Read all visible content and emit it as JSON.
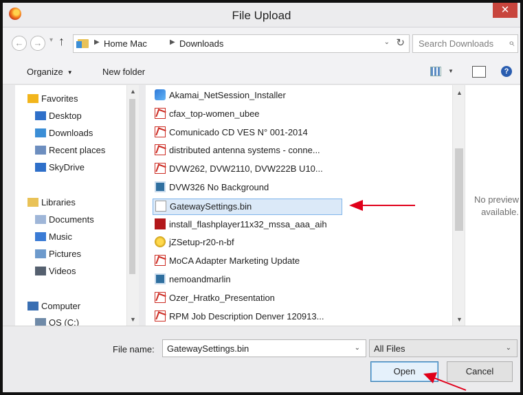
{
  "window": {
    "title": "File Upload",
    "close_glyph": "✕"
  },
  "address": {
    "crumbs": [
      "Home Mac",
      "Downloads"
    ],
    "search_placeholder": "Search Downloads"
  },
  "toolbar": {
    "organize_label": "Organize",
    "new_folder_label": "New folder"
  },
  "sidebar": {
    "items": [
      {
        "label": "Favorites",
        "icon": "star-icon"
      },
      {
        "label": "Desktop",
        "icon": "desktop-icon"
      },
      {
        "label": "Downloads",
        "icon": "downloads-icon"
      },
      {
        "label": "Recent places",
        "icon": "recent-places-icon"
      },
      {
        "label": "SkyDrive",
        "icon": "skydrive-icon"
      },
      {
        "label": "Libraries",
        "icon": "libraries-icon"
      },
      {
        "label": "Documents",
        "icon": "documents-icon"
      },
      {
        "label": "Music",
        "icon": "music-icon"
      },
      {
        "label": "Pictures",
        "icon": "pictures-icon"
      },
      {
        "label": "Videos",
        "icon": "videos-icon"
      },
      {
        "label": "Computer",
        "icon": "computer-icon"
      },
      {
        "label": "OS (C:)",
        "icon": "drive-icon"
      }
    ]
  },
  "files": [
    {
      "name": "Akamai_NetSession_Installer",
      "icon": "app-icon"
    },
    {
      "name": "cfax_top-women_ubee",
      "icon": "pdf-icon"
    },
    {
      "name": "Comunicado CD VES N° 001-2014",
      "icon": "pdf-icon"
    },
    {
      "name": "distributed antenna systems - conne...",
      "icon": "pdf-icon"
    },
    {
      "name": "DVW262, DVW2110, DVW222B U10...",
      "icon": "pdf-icon"
    },
    {
      "name": "DVW326 No Background",
      "icon": "image-icon"
    },
    {
      "name": "GatewaySettings.bin",
      "icon": "file-icon",
      "selected": true
    },
    {
      "name": "install_flashplayer11x32_mssa_aaa_aih",
      "icon": "flash-icon"
    },
    {
      "name": "jZSetup-r20-n-bf",
      "icon": "setup-icon"
    },
    {
      "name": "MoCA Adapter Marketing Update",
      "icon": "pdf-icon"
    },
    {
      "name": "nemoandmarlin",
      "icon": "image-icon"
    },
    {
      "name": "Ozer_Hratko_Presentation",
      "icon": "pdf-icon"
    },
    {
      "name": "RPM Job Description Denver 120913...",
      "icon": "pdf-icon"
    }
  ],
  "preview": {
    "text": "No preview available."
  },
  "footer": {
    "filename_label": "File name:",
    "filename_value": "GatewaySettings.bin",
    "filetype_value": "All Files",
    "open_label": "Open",
    "cancel_label": "Cancel"
  },
  "colors": {
    "annotation_arrow": "#e0001a",
    "selection": "#dbe9f8"
  }
}
